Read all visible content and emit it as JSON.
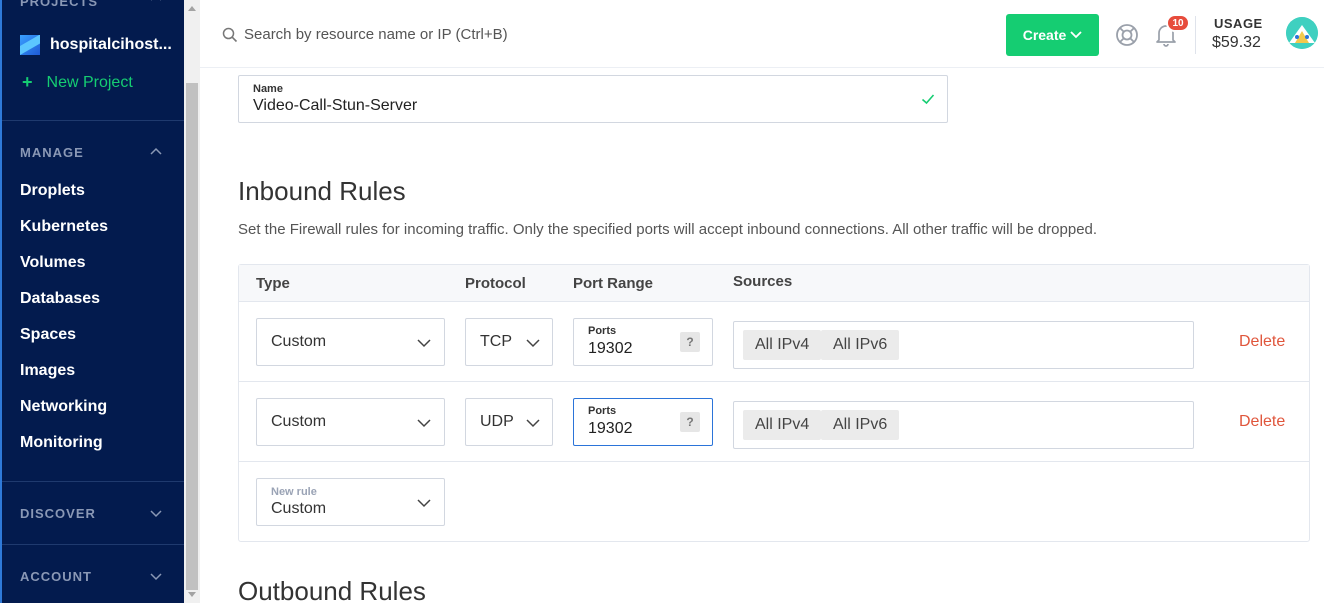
{
  "sidebar": {
    "projects_heading": "PROJECTS",
    "project_name": "hospitalcihost...",
    "new_project_label": "New Project",
    "manage_heading": "MANAGE",
    "manage_items": [
      "Droplets",
      "Kubernetes",
      "Volumes",
      "Databases",
      "Spaces",
      "Images",
      "Networking",
      "Monitoring"
    ],
    "discover_heading": "DISCOVER",
    "account_heading": "ACCOUNT"
  },
  "header": {
    "search_placeholder": "Search by resource name or IP (Ctrl+B)",
    "create_label": "Create",
    "notification_count": "10",
    "usage_label": "USAGE",
    "usage_value": "$59.32"
  },
  "firewall": {
    "name_label": "Name",
    "name_value": "Video-Call-Stun-Server",
    "inbound_title": "Inbound Rules",
    "inbound_description": "Set the Firewall rules for incoming traffic. Only the specified ports will accept inbound connections. All other traffic will be dropped.",
    "columns": {
      "type": "Type",
      "protocol": "Protocol",
      "port_range": "Port Range",
      "sources": "Sources"
    },
    "rules": [
      {
        "type": "Custom",
        "protocol": "TCP",
        "ports_label": "Ports",
        "ports_value": "19302",
        "ports_help": "?",
        "sources": [
          "All IPv4",
          "All IPv6"
        ],
        "delete_label": "Delete"
      },
      {
        "type": "Custom",
        "protocol": "UDP",
        "ports_label": "Ports",
        "ports_value": "19302",
        "ports_help": "?",
        "sources": [
          "All IPv4",
          "All IPv6"
        ],
        "delete_label": "Delete"
      }
    ],
    "new_rule_label": "New rule",
    "new_rule_value": "Custom",
    "outbound_title": "Outbound Rules"
  },
  "colors": {
    "sidebar_bg": "#031b4e",
    "accent_green": "#15cd72",
    "delete_red": "#e0563c",
    "focus_blue": "#2b74d9"
  }
}
